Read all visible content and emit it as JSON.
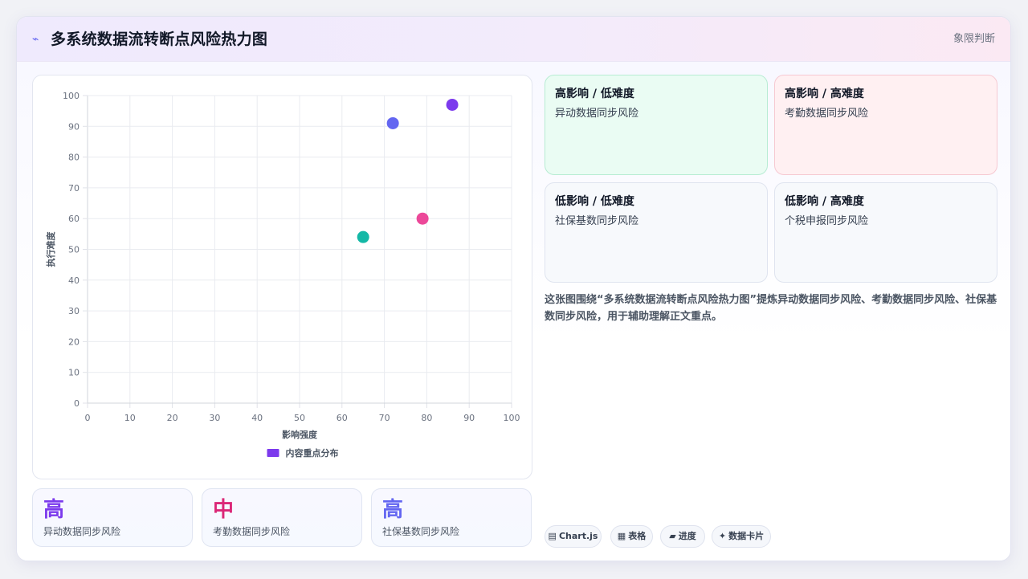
{
  "header": {
    "icon": "lightning-icon",
    "title": "多系统数据流转断点风险热力图",
    "tag": "象限判断"
  },
  "colors": {
    "purple": "#7c3aed",
    "indigo": "#6366f1",
    "pink": "#ec4899",
    "teal": "#14b8a6"
  },
  "chart_data": {
    "type": "scatter",
    "xlabel": "影响强度",
    "ylabel": "执行难度",
    "xlim": [
      0,
      100
    ],
    "ylim": [
      0,
      100
    ],
    "xticks": [
      0,
      10,
      20,
      30,
      40,
      50,
      60,
      70,
      80,
      90,
      100
    ],
    "yticks": [
      0,
      10,
      20,
      30,
      40,
      50,
      60,
      70,
      80,
      90,
      100
    ],
    "grid": true,
    "legend": "bottom",
    "series": [
      {
        "name": "内容重点分布",
        "points": [
          {
            "x": 86,
            "y": 97,
            "color": "#7c3aed"
          },
          {
            "x": 72,
            "y": 91,
            "color": "#6366f1"
          },
          {
            "x": 79,
            "y": 60,
            "color": "#ec4899"
          },
          {
            "x": 65,
            "y": 54,
            "color": "#14b8a6"
          }
        ]
      }
    ]
  },
  "stats": [
    {
      "value": "高",
      "label": "异动数据同步风险",
      "color": "#7c3aed"
    },
    {
      "value": "中",
      "label": "考勤数据同步风险",
      "color": "#db2777"
    },
    {
      "value": "高",
      "label": "社保基数同步风险",
      "color": "#6366f1"
    }
  ],
  "quadrants": [
    {
      "title": "高影响 / 低难度",
      "item": "异动数据同步风险",
      "bg": "#eafcf3",
      "border": "#b7ecd3"
    },
    {
      "title": "高影响 / 高难度",
      "item": "考勤数据同步风险",
      "bg": "#fff0f2",
      "border": "#f6c9d2"
    },
    {
      "title": "低影响 / 低难度",
      "item": "社保基数同步风险",
      "bg": "#f7f9fc",
      "border": "#dfe4ef"
    },
    {
      "title": "低影响 / 高难度",
      "item": "个税申报同步风险",
      "bg": "#f7f9fc",
      "border": "#dfe4ef"
    }
  ],
  "summary": "这张图围绕“多系统数据流转断点风险热力图”提炼异动数据同步风险、考勤数据同步风险、社保基数同步风险，用于辅助理解正文重点。",
  "chips": [
    {
      "icon": "▤",
      "icon_name": "chart-icon",
      "label": "Chart.js"
    },
    {
      "icon": "▦",
      "icon_name": "table-icon",
      "label": "表格"
    },
    {
      "icon": "▰",
      "icon_name": "progress-icon",
      "label": "进度"
    },
    {
      "icon": "✦",
      "icon_name": "sparkle-icon",
      "label": "数据卡片"
    }
  ]
}
